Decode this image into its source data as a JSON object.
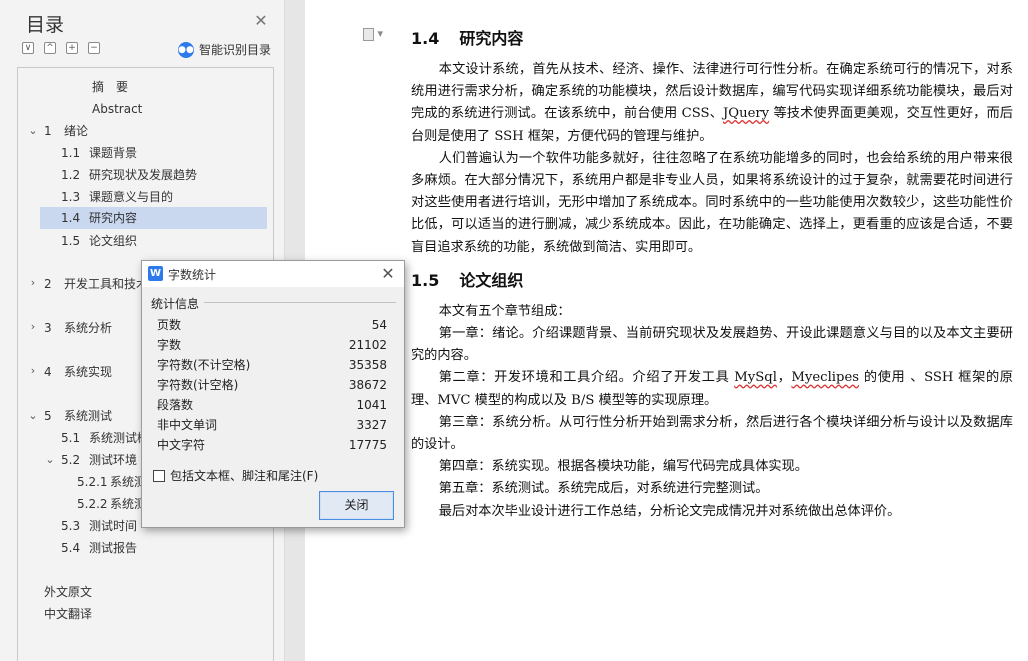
{
  "toc": {
    "title": "目录",
    "smart_label": "智能识别目录",
    "tool_buttons": [
      "∨",
      "^",
      "+",
      "−"
    ],
    "items": [
      {
        "num": "",
        "text": "摘　要"
      },
      {
        "num": "",
        "text": "Abstract"
      },
      {
        "num": "1",
        "text": "绪论"
      },
      {
        "num": "1.1",
        "text": "课题背景"
      },
      {
        "num": "1.2",
        "text": "研究现状及发展趋势"
      },
      {
        "num": "1.3",
        "text": "课题意义与目的"
      },
      {
        "num": "1.4",
        "text": "研究内容"
      },
      {
        "num": "1.5",
        "text": "论文组织"
      },
      {
        "num": "2",
        "text": "开发工具和技术"
      },
      {
        "num": "3",
        "text": "系统分析"
      },
      {
        "num": "4",
        "text": "系统实现"
      },
      {
        "num": "5",
        "text": "系统测试"
      },
      {
        "num": "5.1",
        "text": "系统测试概"
      },
      {
        "num": "5.2",
        "text": "测试环境"
      },
      {
        "num": "5.2.1",
        "text": "系统测"
      },
      {
        "num": "5.2.2",
        "text": "系统测"
      },
      {
        "num": "5.3",
        "text": "测试时间"
      },
      {
        "num": "5.4",
        "text": "测试报告"
      },
      {
        "num": "",
        "text": "外文原文"
      },
      {
        "num": "",
        "text": "中文翻译"
      }
    ]
  },
  "document": {
    "section1": {
      "num": "1.4",
      "title": "研究内容",
      "p1": "本文设计系统，首先从技术、经济、操作、法律进行可行性分析。在确定系统可行的情况下，对系统用进行需求分析，确定系统的功能模块，然后设计数据库，编写代码实现详细系统功能模块，最后对完成的系统进行测试。在该系统中，前台使用 CSS、",
      "jquery": "JQuery",
      "p1b": " 等技术使界面更美观，交互性更好，而后台则是使用了 SSH 框架，方便代码的管理与维护。",
      "p2": "人们普遍认为一个软件功能多就好，往往忽略了在系统功能增多的同时，也会给系统的用户带来很多麻烦。在大部分情况下，系统用户都是非专业人员，如果将系统设计的过于复杂，就需要花时间进行对这些使用者进行培训，无形中增加了系统成本。同时系统中的一些功能使用次数较少，这些功能性价比低，可以适当的进行删减，减少系统成本。因此，在功能确定、选择上，更看重的应该是合适，不要盲目追求系统的功能，系统做到简洁、实用即可。"
    },
    "section2": {
      "num": "1.5",
      "title": "论文组织",
      "p1": "本文有五个章节组成：",
      "p2": "第一章：绪论。介绍课题背景、当前研究现状及发展趋势、开设此课题意义与目的以及本文主要研究的内容。",
      "p3a": "第二章：开发环境和工具介绍。介绍了开发工具 ",
      "mysql": "MySql",
      "p3b": "，",
      "myeclipes": "Myeclipes",
      "p3c": " 的使用 、SSH 框架的原理、MVC 模型的构成以及 B/S 模型等的实现原理。",
      "p4": "第三章：系统分析。从可行性分析开始到需求分析，然后进行各个模块详细分析与设计以及数据库的设计。",
      "p5": "第四章：系统实现。根据各模块功能，编写代码完成具体实现。",
      "p6": "第五章：系统测试。系统完成后，对系统进行完整测试。",
      "p7": "最后对本次毕业设计进行工作总结，分析论文完成情况并对系统做出总体评价。"
    }
  },
  "dialog": {
    "title": "字数统计",
    "section_label": "统计信息",
    "stats": [
      {
        "label": "页数",
        "value": "54"
      },
      {
        "label": "字数",
        "value": "21102"
      },
      {
        "label": "字符数(不计空格)",
        "value": "35358"
      },
      {
        "label": "字符数(计空格)",
        "value": "38672"
      },
      {
        "label": "段落数",
        "value": "1041"
      },
      {
        "label": "非中文单词",
        "value": "3327"
      },
      {
        "label": "中文字符",
        "value": "17775"
      }
    ],
    "checkbox_label": "包括文本框、脚注和尾注(F)",
    "checkbox_checked": false,
    "close_button": "关闭"
  },
  "colors": {
    "accent": "#2d7bea",
    "toc_active": "#c9d7ef",
    "spellcheck": "#d33"
  }
}
